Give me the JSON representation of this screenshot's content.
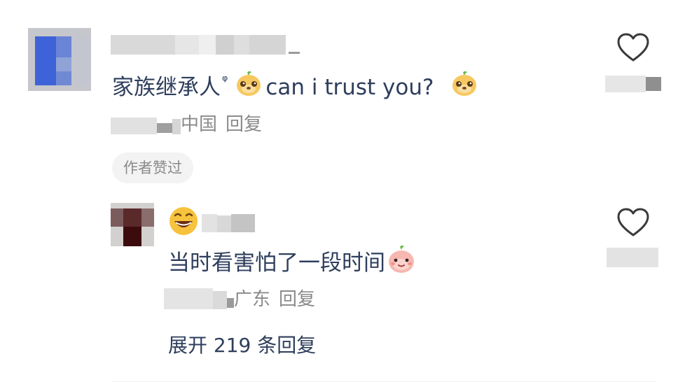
{
  "comment": {
    "text": "家族继承人",
    "tag_glyph": "ᵠ",
    "text_en": "can i trust you?",
    "emoji_name": "bear-face-emoji",
    "location": "中国",
    "reply_label": "回复",
    "author_badge": "作者赞过",
    "like_icon": "heart-outline-icon"
  },
  "reply": {
    "text": "当时看害怕了一段时间",
    "emoji_name": "peach-face-emoji",
    "name_prefix_emoji": "grinning-face-emoji",
    "location": "广东",
    "reply_label": "回复",
    "like_icon": "heart-outline-icon"
  },
  "expand": {
    "label": "展开 219 条回复"
  },
  "colors": {
    "text": "#2e3e5c",
    "meta": "#8a8a8a",
    "badge_bg": "#f3f3f3"
  }
}
